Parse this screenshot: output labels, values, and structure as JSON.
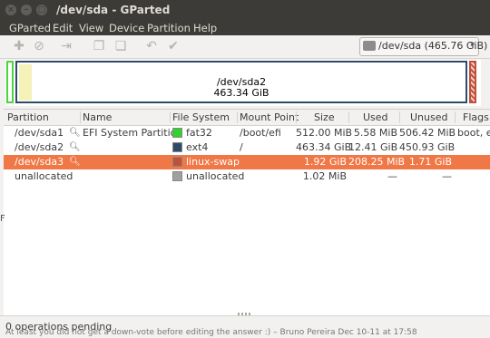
{
  "window": {
    "title": "/dev/sda - GParted"
  },
  "menu": [
    "GParted",
    "Edit",
    "View",
    "Device",
    "Partition",
    "Help"
  ],
  "toolbar": {
    "icons": [
      "new-partition-icon",
      "delete-icon",
      "resize-move-icon",
      "copy-icon",
      "paste-icon",
      "undo-icon",
      "apply-icon"
    ]
  },
  "device_selector": {
    "label": "/dev/sda  (465.76 GiB)"
  },
  "disk_map": {
    "name": "/dev/sda2",
    "size": "463.34 GiB"
  },
  "table": {
    "headers": [
      "Partition",
      "Name",
      "File System",
      "Mount Point",
      "Size",
      "Used",
      "Unused",
      "Flags"
    ],
    "rows": [
      {
        "partition": "/dev/sda1",
        "name": "EFI System Partition",
        "fs": "fat32",
        "fs_color": "#2ed42a",
        "mount": "/boot/efi",
        "size": "512.00 MiB",
        "used": "5.58 MiB",
        "unused": "506.42 MiB",
        "flags": "boot, es",
        "selected": false,
        "has_mag": true
      },
      {
        "partition": "/dev/sda2",
        "name": "",
        "fs": "ext4",
        "fs_color": "#2e4a6b",
        "mount": "/",
        "size": "463.34 GiB",
        "used": "12.41 GiB",
        "unused": "450.93 GiB",
        "flags": "",
        "selected": false,
        "has_mag": true
      },
      {
        "partition": "/dev/sda3",
        "name": "",
        "fs": "linux-swap",
        "fs_color": "#c0503a",
        "mount": "",
        "size": "1.92 GiB",
        "used": "208.25 MiB",
        "unused": "1.71 GiB",
        "flags": "",
        "selected": true,
        "has_mag": true
      },
      {
        "partition": "unallocated",
        "name": "",
        "fs": "unallocated",
        "fs_color": "#a0a0a0",
        "mount": "",
        "size": "1.02 MiB",
        "used": "—",
        "unused": "—",
        "flags": "",
        "selected": false,
        "has_mag": false
      }
    ]
  },
  "status": {
    "text": "0 operations pending"
  },
  "background_text": {
    "left_edge": "F",
    "bottom": "At least you did not get a down-vote before editing the answer :) – Bruno Pereira Dec 10-11 at 17:58"
  },
  "colors": {
    "selection": "#f07746",
    "titlebar": "#3c3b37"
  }
}
